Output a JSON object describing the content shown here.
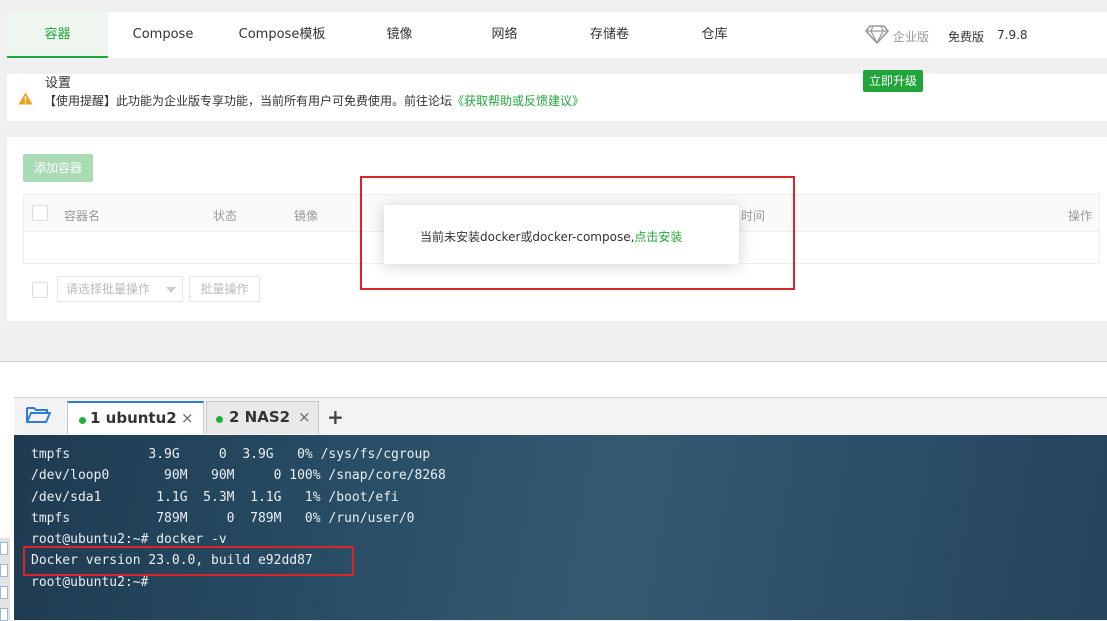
{
  "nav": {
    "tabs": [
      "容器",
      "Compose",
      "Compose模板",
      "镜像",
      "网络",
      "存储卷",
      "仓库"
    ],
    "settings": "设置",
    "enterprise": "企业版",
    "free": "免费版",
    "version": "7.9.8",
    "upgrade": "立即升级"
  },
  "notice": {
    "text": "【使用提醒】此功能为企业版专享功能，当前所有用户可免费使用。前往论坛",
    "link": "《获取帮助或反馈建议》"
  },
  "container": {
    "add_button": "添加容器",
    "columns": [
      "容器名",
      "状态",
      "镜像",
      "时间",
      "操作"
    ],
    "batch_placeholder": "请选择批量操作",
    "batch_button": "批量操作"
  },
  "modal": {
    "text": "当前未安装docker或docker-compose,",
    "link": "点击安装"
  },
  "terminal": {
    "tabs": [
      {
        "label": "1 ubuntu2",
        "close": "×"
      },
      {
        "label": "2 NAS2",
        "close": "×"
      }
    ],
    "add": "+",
    "lines": [
      "tmpfs          3.9G     0  3.9G   0% /sys/fs/cgroup",
      "/dev/loop0       90M   90M     0 100% /snap/core/8268",
      "/dev/sda1       1.1G  5.3M  1.1G   1% /boot/efi",
      "tmpfs           789M     0  789M   0% /run/user/0",
      "root@ubuntu2:~# docker -v",
      "Docker version 23.0.0, build e92dd87",
      "root@ubuntu2:~#"
    ]
  },
  "colors": {
    "accent": "#20a53a",
    "highlight_box": "#d9252a",
    "terminal_bg": "#2a5068"
  }
}
